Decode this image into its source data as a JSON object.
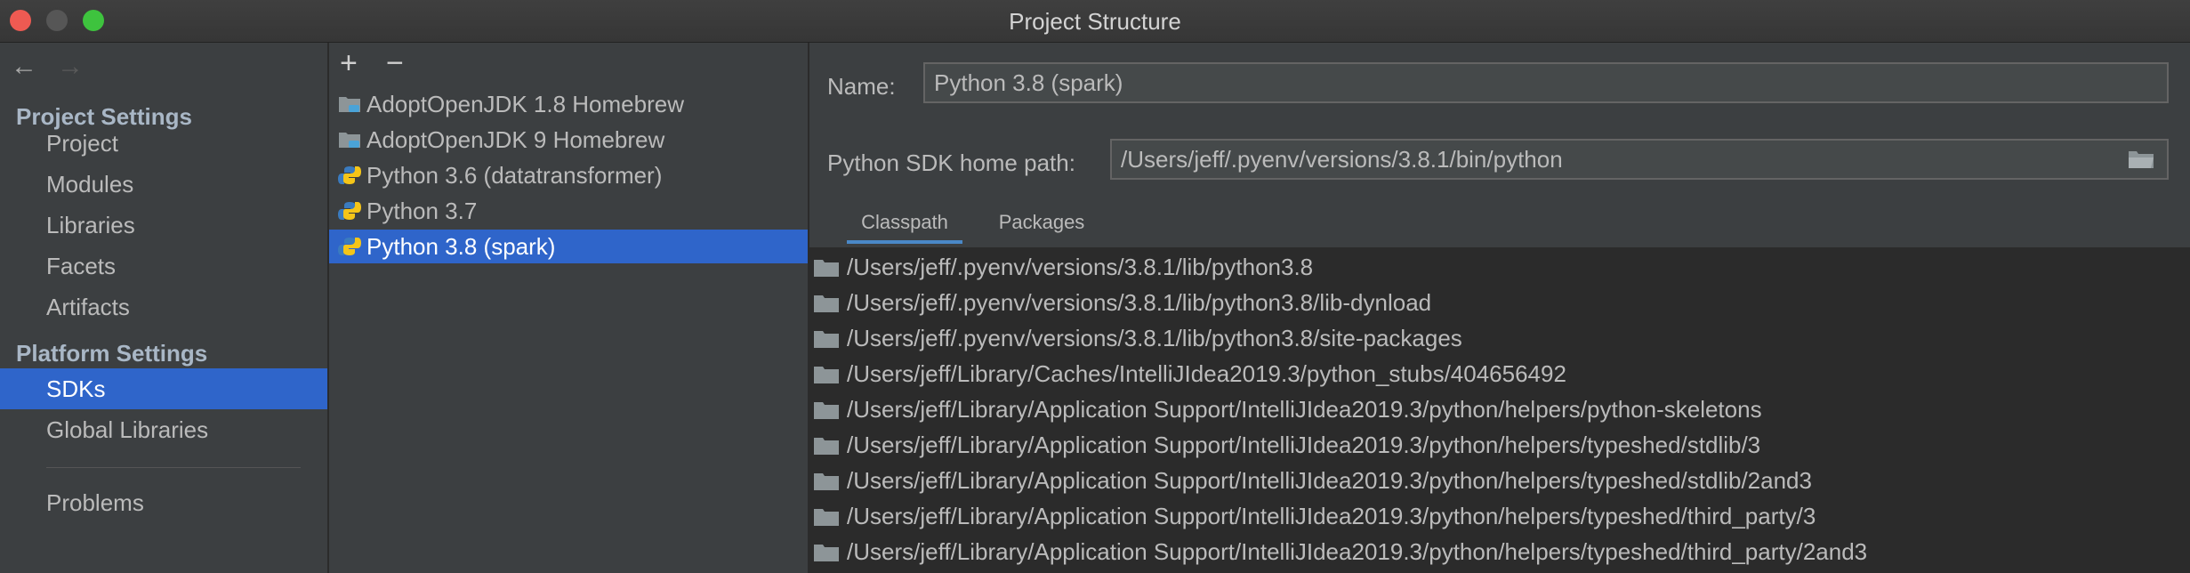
{
  "window": {
    "title": "Project Structure"
  },
  "nav": {
    "project_settings_header": "Project Settings",
    "platform_settings_header": "Platform Settings",
    "items": [
      {
        "label": "Project"
      },
      {
        "label": "Modules"
      },
      {
        "label": "Libraries"
      },
      {
        "label": "Facets"
      },
      {
        "label": "Artifacts"
      },
      {
        "label": "SDKs",
        "selected": true
      },
      {
        "label": "Global Libraries"
      },
      {
        "label": "Problems"
      }
    ]
  },
  "toolbar": {
    "add": "+",
    "remove": "−"
  },
  "sdks": [
    {
      "label": "AdoptOpenJDK 1.8 Homebrew",
      "icon": "jdk-folder-icon"
    },
    {
      "label": "AdoptOpenJDK 9 Homebrew",
      "icon": "jdk-folder-icon"
    },
    {
      "label": "Python 3.6 (datatransformer)",
      "icon": "python-icon"
    },
    {
      "label": "Python 3.7",
      "icon": "python-icon"
    },
    {
      "label": "Python 3.8 (spark)",
      "icon": "python-icon",
      "selected": true
    }
  ],
  "detail": {
    "name_label": "Name:",
    "name_value": "Python 3.8 (spark)",
    "home_label": "Python SDK home path:",
    "home_value": "/Users/jeff/.pyenv/versions/3.8.1/bin/python",
    "tabs": [
      {
        "label": "Classpath",
        "active": true
      },
      {
        "label": "Packages"
      }
    ],
    "classpath": [
      "/Users/jeff/.pyenv/versions/3.8.1/lib/python3.8",
      "/Users/jeff/.pyenv/versions/3.8.1/lib/python3.8/lib-dynload",
      "/Users/jeff/.pyenv/versions/3.8.1/lib/python3.8/site-packages",
      "/Users/jeff/Library/Caches/IntelliJIdea2019.3/python_stubs/404656492",
      "/Users/jeff/Library/Application Support/IntelliJIdea2019.3/python/helpers/python-skeletons",
      "/Users/jeff/Library/Application Support/IntelliJIdea2019.3/python/helpers/typeshed/stdlib/3",
      "/Users/jeff/Library/Application Support/IntelliJIdea2019.3/python/helpers/typeshed/stdlib/2and3",
      "/Users/jeff/Library/Application Support/IntelliJIdea2019.3/python/helpers/typeshed/third_party/3",
      "/Users/jeff/Library/Application Support/IntelliJIdea2019.3/python/helpers/typeshed/third_party/2and3"
    ]
  },
  "colors": {
    "selection": "#2f65ca",
    "background": "#3c3f41",
    "list_background": "#2b2b2b",
    "close": "#ee5a52",
    "maximize": "#3ec33e"
  }
}
